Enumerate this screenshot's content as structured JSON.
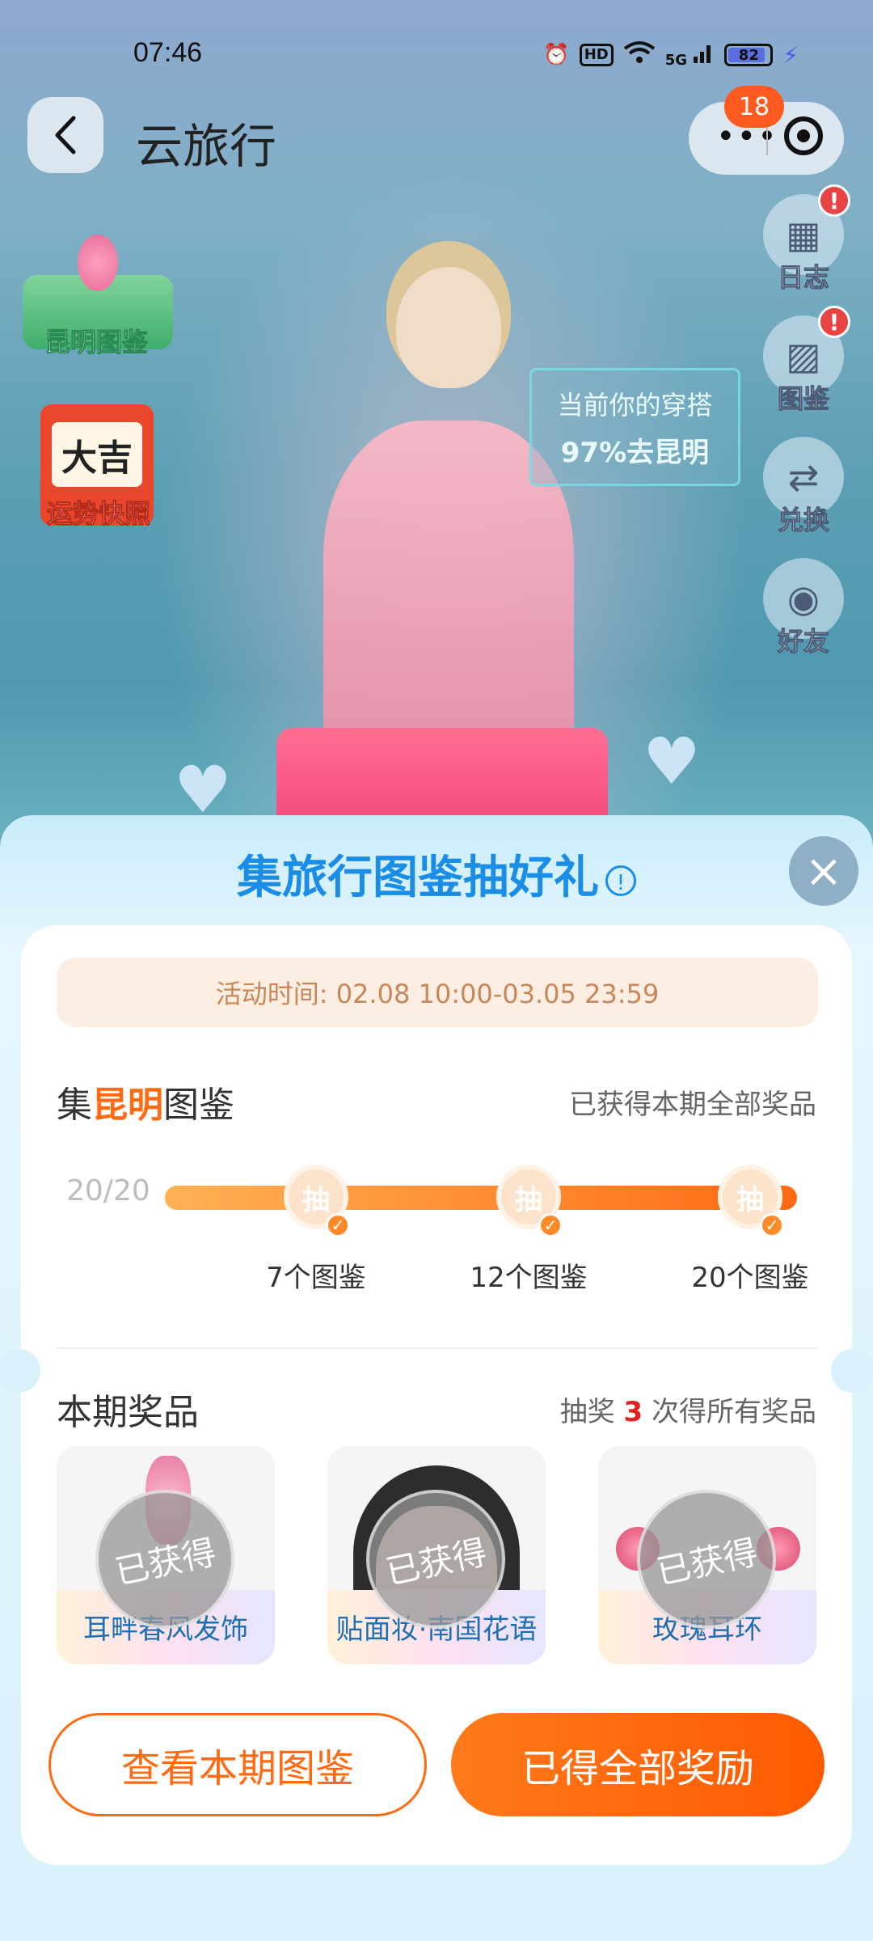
{
  "status_bar": {
    "time": "07:46",
    "hd": "HD",
    "network": "5G",
    "battery": "82",
    "icons": [
      "alarm-icon",
      "hd-icon",
      "wifi-icon",
      "signal-icon",
      "battery-icon",
      "charging-icon"
    ]
  },
  "nav": {
    "title": "云旅行",
    "more_badge": "18"
  },
  "left_widgets": {
    "kunming_book": "昆明图鉴",
    "fortune_char": "大吉",
    "fortune_label": "运势快照"
  },
  "outfit_bubble": {
    "line1": "当前你的穿搭",
    "line2": "97%去昆明"
  },
  "side_menu": [
    {
      "label": "日志",
      "icon": "calendar-icon",
      "alert": "!"
    },
    {
      "label": "图鉴",
      "icon": "picture-icon",
      "alert": "!"
    },
    {
      "label": "兑换",
      "icon": "exchange-icon"
    },
    {
      "label": "好友",
      "icon": "friends-icon"
    }
  ],
  "sheet": {
    "title": "集旅行图鉴抽好礼",
    "info_icon": "!",
    "close": "×",
    "activity_time": "活动时间: 02.08 10:00-03.05 23:59",
    "collect_prefix": "集",
    "collect_city": "昆明",
    "collect_suffix": "图鉴",
    "collect_status": "已获得本期全部奖品",
    "progress": {
      "count": "20/20",
      "fraction": 1.0,
      "draw_label": "抽",
      "milestones": [
        "7个图鉴",
        "12个图鉴",
        "20个图鉴"
      ]
    },
    "prizes_title": "本期奖品",
    "prizes_note_prefix": "抽奖 ",
    "prizes_note_num": "3",
    "prizes_note_suffix": " 次得所有奖品",
    "obtained_stamp": "已获得",
    "prizes": [
      {
        "name": "耳畔春风发饰"
      },
      {
        "name": "贴面妆·南国花语"
      },
      {
        "name": "玫瑰耳环"
      }
    ],
    "btn_view": "查看本期图鉴",
    "btn_done": "已得全部奖励"
  },
  "colors": {
    "accent_orange": "#ff6a12",
    "title_blue": "#1a8ee6",
    "alert_red": "#e84343"
  }
}
